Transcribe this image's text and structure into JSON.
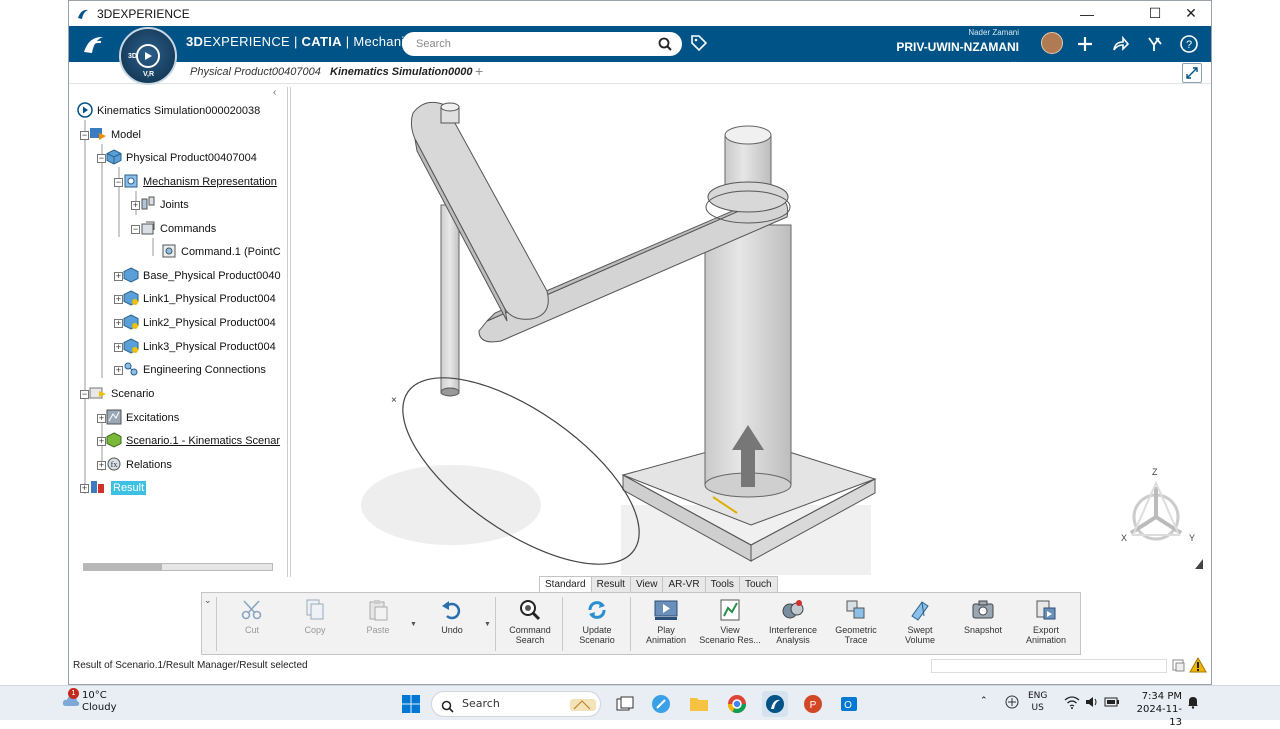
{
  "window": {
    "title": "3DEXPERIENCE",
    "controls": {
      "minimize": "—",
      "maximize": "☐",
      "close": "✕"
    }
  },
  "header": {
    "brand_3d": "3D",
    "brand_experience": "EXPERIENCE",
    "brand_sep": " | ",
    "brand_catia": "CATIA",
    "brand_app": " | Mechanical...",
    "compass_label": "V,R",
    "compass_3d": "3D",
    "search_placeholder": "Search",
    "user_name": "Nader Zamani",
    "tenant": "PRIV-UWIN-NZAMANI",
    "colors": {
      "bar": "#005386",
      "accent": "#3cc1e3"
    }
  },
  "tabs": [
    {
      "label": "Physical Product00407004"
    },
    {
      "label": "Kinematics Simulation0000"
    }
  ],
  "tree": {
    "root": "Kinematics Simulation000020038",
    "model": "Model",
    "physical_product": "Physical Product00407004",
    "mechanism": "Mechanism Representation",
    "joints": "Joints",
    "commands": "Commands",
    "command1": "Command.1 (PointC",
    "base": "Base_Physical Product0040",
    "link1": "Link1_Physical Product004",
    "link2": "Link2_Physical Product004",
    "link3": "Link3_Physical Product004",
    "engineering": "Engineering Connections",
    "scenario": "Scenario",
    "excitations": "Excitations",
    "scenario1": "Scenario.1 - Kinematics Scenar",
    "relations": "Relations",
    "result": "Result"
  },
  "compass_axes": {
    "z": "Z",
    "x": "X",
    "y": "Y"
  },
  "section_tabs": [
    "Standard",
    "Result",
    "View",
    "AR-VR",
    "Tools",
    "Touch"
  ],
  "actions": {
    "cut": "Cut",
    "copy": "Copy",
    "paste": "Paste",
    "undo": "Undo",
    "command_search_1": "Command",
    "command_search_2": "Search",
    "update_scenario_1": "Update",
    "update_scenario_2": "Scenario",
    "play_animation_1": "Play",
    "play_animation_2": "Animation",
    "view_results_1": "View",
    "view_results_2": "Scenario Res...",
    "interference_1": "Interference",
    "interference_2": "Analysis",
    "geo_trace_1": "Geometric",
    "geo_trace_2": "Trace",
    "swept_1": "Swept",
    "swept_2": "Volume",
    "snapshot": "Snapshot",
    "export_1": "Export",
    "export_2": "Animation"
  },
  "status": {
    "message": "Result of Scenario.1/Result Manager/Result selected"
  },
  "taskbar": {
    "weather_temp": "10°C",
    "weather_desc": "Cloudy",
    "notification_count": "1",
    "search_label": "Search",
    "lang_1": "ENG",
    "lang_2": "US",
    "time": "7:34 PM",
    "date": "2024-11-13"
  }
}
